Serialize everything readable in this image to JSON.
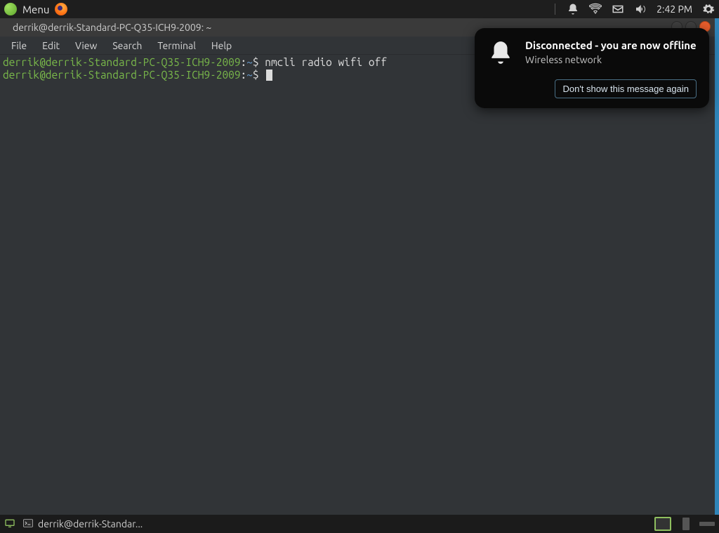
{
  "top_panel": {
    "menu_label": "Menu",
    "clock": "2:42 PM"
  },
  "terminal": {
    "title": "derrik@derrik-Standard-PC-Q35-ICH9-2009: ~",
    "menubar": {
      "file": "File",
      "edit": "Edit",
      "view": "View",
      "search": "Search",
      "terminal": "Terminal",
      "help": "Help"
    },
    "lines": {
      "l1_host": "derrik@derrik-Standard-PC-Q35-ICH9-2009",
      "l1_path": "~",
      "l1_cmd": "nmcli radio wifi off",
      "l2_host": "derrik@derrik-Standard-PC-Q35-ICH9-2009",
      "l2_path": "~"
    }
  },
  "notification": {
    "title": "Disconnected - you are now offline",
    "subtitle": "Wireless network",
    "button": "Don't show this message again"
  },
  "taskbar": {
    "entry_label": "derrik@derrik-Standar..."
  }
}
